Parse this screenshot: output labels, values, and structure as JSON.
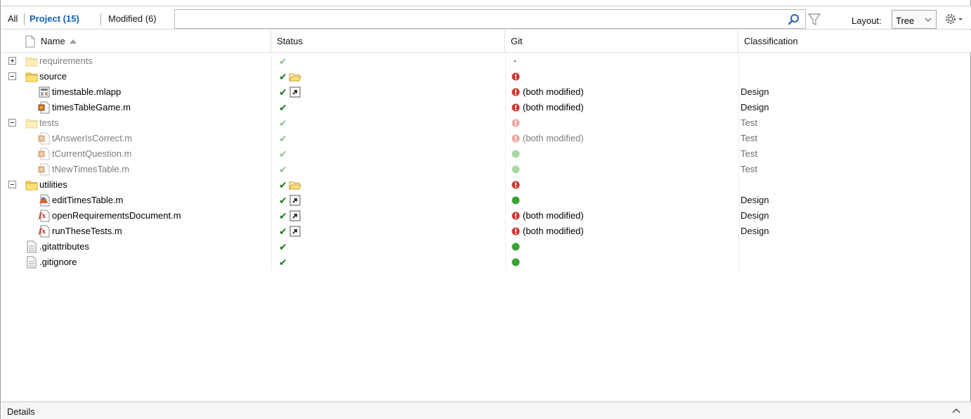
{
  "toolbar": {
    "tabs": [
      {
        "label": "All",
        "active": false
      },
      {
        "label": "Project (15)",
        "active": true
      },
      {
        "label": "Modified (6)",
        "active": false
      }
    ],
    "search_value": "",
    "search_icon": "magnifier-icon",
    "filter_icon": "funnel-icon",
    "layout_label": "Layout:",
    "layout_value": "Tree",
    "settings_icon": "gear-icon",
    "accent_color": "#1a5fb4"
  },
  "columns": {
    "name": "Name",
    "status": "Status",
    "git": "Git",
    "classification": "Classification"
  },
  "files": [
    {
      "name": "requirements",
      "kind": "folder",
      "expander": "plus",
      "dim": true,
      "status_extra": "",
      "git_state": "dot",
      "git_text": "",
      "classification": ""
    },
    {
      "name": "source",
      "kind": "folder",
      "expander": "minus",
      "dim": false,
      "status_extra": "folder-open-icon",
      "git_state": "conflict",
      "git_text": "",
      "classification": ""
    },
    {
      "name": "timestable.mlapp",
      "kind": "mlapp",
      "expander": "",
      "dim": false,
      "status_extra": "shortcut-icon",
      "git_state": "conflict",
      "git_text": "(both modified)",
      "classification": "Design"
    },
    {
      "name": "timesTableGame.m",
      "kind": "class",
      "expander": "",
      "dim": false,
      "status_extra": "",
      "git_state": "conflict",
      "git_text": "(both modified)",
      "classification": "Design"
    },
    {
      "name": "tests",
      "kind": "folder",
      "expander": "minus",
      "dim": true,
      "status_extra": "",
      "git_state": "conflict",
      "git_text": "",
      "classification": "Test"
    },
    {
      "name": "tAnswerIsCorrect.m",
      "kind": "class",
      "expander": "",
      "dim": true,
      "status_extra": "",
      "git_state": "conflict",
      "git_text": "(both modified)",
      "classification": "Test"
    },
    {
      "name": "tCurrentQuestion.m",
      "kind": "class",
      "expander": "",
      "dim": true,
      "status_extra": "",
      "git_state": "ok",
      "git_text": "",
      "classification": "Test"
    },
    {
      "name": "tNewTimesTable.m",
      "kind": "class",
      "expander": "",
      "dim": true,
      "status_extra": "",
      "git_state": "ok",
      "git_text": "",
      "classification": "Test"
    },
    {
      "name": "utilities",
      "kind": "folder",
      "expander": "minus",
      "dim": false,
      "status_extra": "folder-open-icon",
      "git_state": "conflict",
      "git_text": "",
      "classification": ""
    },
    {
      "name": "editTimesTable.m",
      "kind": "script",
      "expander": "",
      "dim": false,
      "status_extra": "shortcut-icon",
      "git_state": "ok",
      "git_text": "",
      "classification": "Design"
    },
    {
      "name": "openRequirementsDocument.m",
      "kind": "function",
      "expander": "",
      "dim": false,
      "status_extra": "shortcut-icon",
      "git_state": "conflict",
      "git_text": "(both modified)",
      "classification": "Design"
    },
    {
      "name": "runTheseTests.m",
      "kind": "function",
      "expander": "",
      "dim": false,
      "status_extra": "shortcut-icon",
      "git_state": "conflict",
      "git_text": "(both modified)",
      "classification": "Design"
    },
    {
      "name": ".gitattributes",
      "kind": "text",
      "expander": "",
      "dim": false,
      "status_extra": "",
      "git_state": "ok",
      "git_text": "",
      "classification": ""
    },
    {
      "name": ".gitignore",
      "kind": "text",
      "expander": "",
      "dim": false,
      "status_extra": "",
      "git_state": "ok",
      "git_text": "",
      "classification": ""
    }
  ],
  "status_colors": {
    "check": "#1f7a1f",
    "conflict": "#d0342c",
    "ok": "#3aa335"
  },
  "details": {
    "label": "Details",
    "icon": "chevron-up-icon"
  }
}
